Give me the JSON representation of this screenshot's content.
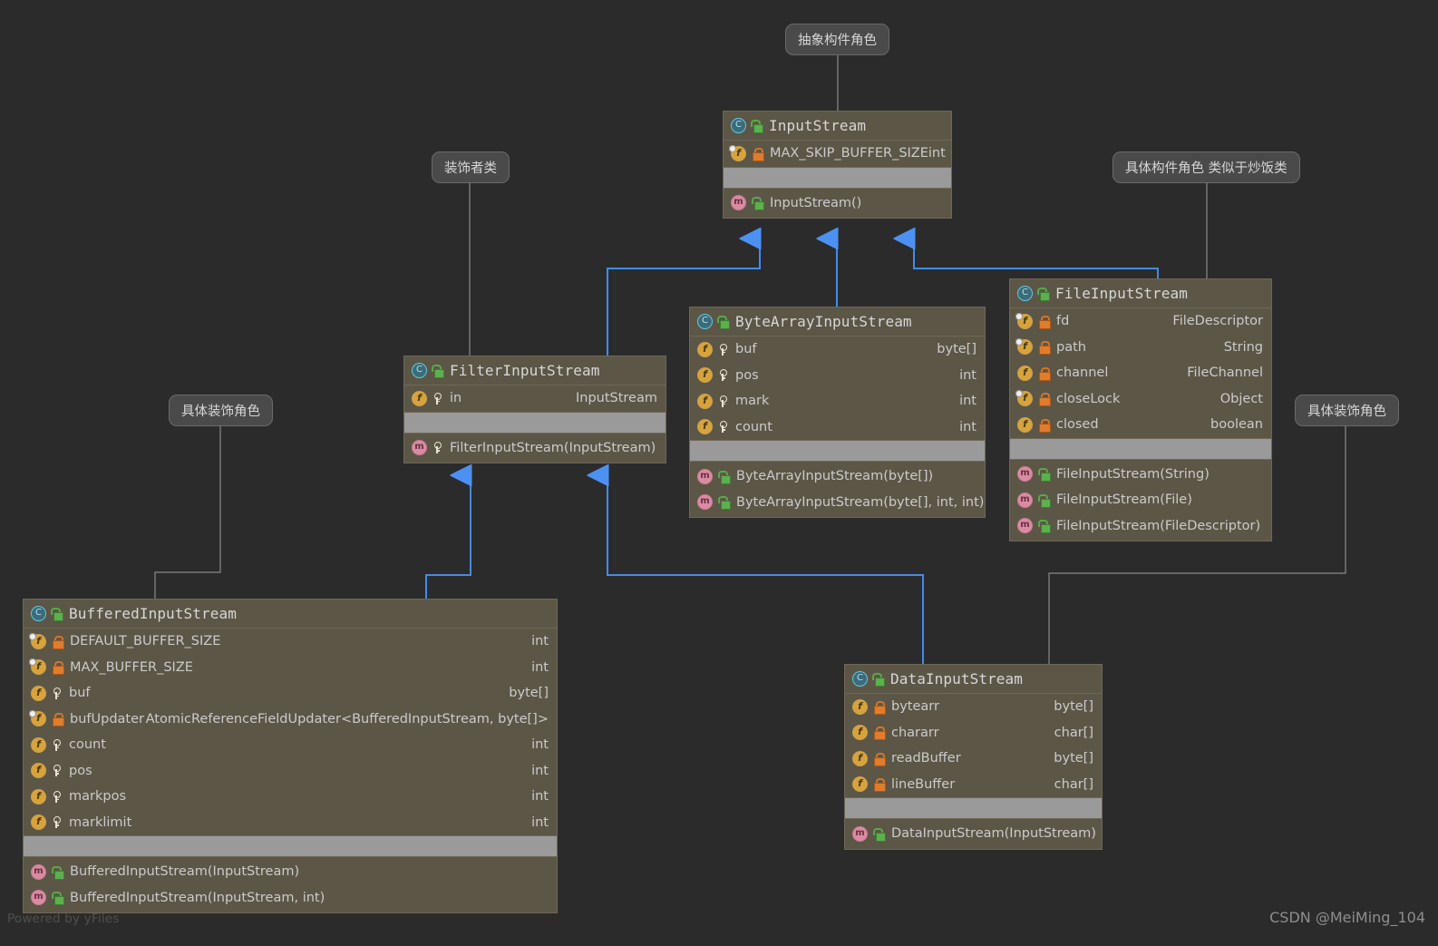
{
  "diagram": {
    "kind": "uml-class-diagram",
    "background": "#2b2b2b",
    "inheritance_color": "#3f8cf0",
    "annotation_line_color": "#8a8a8a",
    "box_fill": "#5c5647",
    "separator_fill": "#9a9a9a"
  },
  "watermarks": {
    "left": "Powered by yFiles",
    "right": "CSDN @MeiMing_104"
  },
  "notes": [
    {
      "id": "note-abstract-component",
      "text": "抽象构件角色",
      "target": "InputStream"
    },
    {
      "id": "note-decorator",
      "text": "装饰者类",
      "target": "FilterInputStream"
    },
    {
      "id": "note-concrete-component",
      "text": "具体构件角色 类似于炒饭类",
      "target": "FileInputStream"
    },
    {
      "id": "note-concrete-decorator-left",
      "text": "具体装饰角色",
      "target": "BufferedInputStream"
    },
    {
      "id": "note-concrete-decorator-right",
      "text": "具体装饰角色",
      "target": "DataInputStream"
    }
  ],
  "classes": {
    "input_stream": {
      "name": "InputStream",
      "icon": "class-icon",
      "visibility": "public",
      "fields": [
        {
          "name": "MAX_SKIP_BUFFER_SIZE",
          "type": "int",
          "modifier": "private",
          "static": true,
          "inline_type": true
        }
      ],
      "methods": [
        {
          "name": "InputStream()",
          "modifier": "public"
        }
      ]
    },
    "filter_input_stream": {
      "name": "FilterInputStream",
      "icon": "class-icon",
      "visibility": "public",
      "fields": [
        {
          "name": "in",
          "type": "InputStream",
          "modifier": "protected",
          "static": false
        }
      ],
      "methods": [
        {
          "name": "FilterInputStream(InputStream)",
          "modifier": "protected"
        }
      ]
    },
    "byte_array_input_stream": {
      "name": "ByteArrayInputStream",
      "icon": "class-icon",
      "visibility": "public",
      "fields": [
        {
          "name": "buf",
          "type": "byte[]",
          "modifier": "protected",
          "static": false
        },
        {
          "name": "pos",
          "type": "int",
          "modifier": "protected",
          "static": false
        },
        {
          "name": "mark",
          "type": "int",
          "modifier": "protected",
          "static": false
        },
        {
          "name": "count",
          "type": "int",
          "modifier": "protected",
          "static": false
        }
      ],
      "methods": [
        {
          "name": "ByteArrayInputStream(byte[])",
          "modifier": "public"
        },
        {
          "name": "ByteArrayInputStream(byte[], int, int)",
          "modifier": "public"
        }
      ]
    },
    "file_input_stream": {
      "name": "FileInputStream",
      "icon": "class-icon",
      "visibility": "public",
      "fields": [
        {
          "name": "fd",
          "type": "FileDescriptor",
          "modifier": "private",
          "static": true
        },
        {
          "name": "path",
          "type": "String",
          "modifier": "private",
          "static": true
        },
        {
          "name": "channel",
          "type": "FileChannel",
          "modifier": "private",
          "static": false
        },
        {
          "name": "closeLock",
          "type": "Object",
          "modifier": "private",
          "static": true
        },
        {
          "name": "closed",
          "type": "boolean",
          "modifier": "private",
          "static": false
        }
      ],
      "methods": [
        {
          "name": "FileInputStream(String)",
          "modifier": "public"
        },
        {
          "name": "FileInputStream(File)",
          "modifier": "public"
        },
        {
          "name": "FileInputStream(FileDescriptor)",
          "modifier": "public"
        }
      ]
    },
    "buffered_input_stream": {
      "name": "BufferedInputStream",
      "icon": "class-icon",
      "visibility": "public",
      "fields": [
        {
          "name": "DEFAULT_BUFFER_SIZE",
          "type": "int",
          "modifier": "private",
          "static": true
        },
        {
          "name": "MAX_BUFFER_SIZE",
          "type": "int",
          "modifier": "private",
          "static": true
        },
        {
          "name": "buf",
          "type": "byte[]",
          "modifier": "protected",
          "static": false
        },
        {
          "name": "bufUpdater",
          "type": "AtomicReferenceFieldUpdater<BufferedInputStream, byte[]>",
          "modifier": "private",
          "static": true,
          "inline_type": true
        },
        {
          "name": "count",
          "type": "int",
          "modifier": "protected",
          "static": false
        },
        {
          "name": "pos",
          "type": "int",
          "modifier": "protected",
          "static": false
        },
        {
          "name": "markpos",
          "type": "int",
          "modifier": "protected",
          "static": false
        },
        {
          "name": "marklimit",
          "type": "int",
          "modifier": "protected",
          "static": false
        }
      ],
      "methods": [
        {
          "name": "BufferedInputStream(InputStream)",
          "modifier": "public"
        },
        {
          "name": "BufferedInputStream(InputStream, int)",
          "modifier": "public"
        }
      ]
    },
    "data_input_stream": {
      "name": "DataInputStream",
      "icon": "class-icon",
      "visibility": "public",
      "fields": [
        {
          "name": "bytearr",
          "type": "byte[]",
          "modifier": "private",
          "static": false
        },
        {
          "name": "chararr",
          "type": "char[]",
          "modifier": "private",
          "static": false
        },
        {
          "name": "readBuffer",
          "type": "byte[]",
          "modifier": "private",
          "static": false
        },
        {
          "name": "lineBuffer",
          "type": "char[]",
          "modifier": "private",
          "static": false
        }
      ],
      "methods": [
        {
          "name": "DataInputStream(InputStream)",
          "modifier": "public"
        }
      ]
    }
  },
  "relations": [
    {
      "from": "FilterInputStream",
      "to": "InputStream",
      "type": "generalization"
    },
    {
      "from": "ByteArrayInputStream",
      "to": "InputStream",
      "type": "generalization"
    },
    {
      "from": "FileInputStream",
      "to": "InputStream",
      "type": "generalization"
    },
    {
      "from": "BufferedInputStream",
      "to": "FilterInputStream",
      "type": "generalization"
    },
    {
      "from": "DataInputStream",
      "to": "FilterInputStream",
      "type": "generalization"
    }
  ]
}
